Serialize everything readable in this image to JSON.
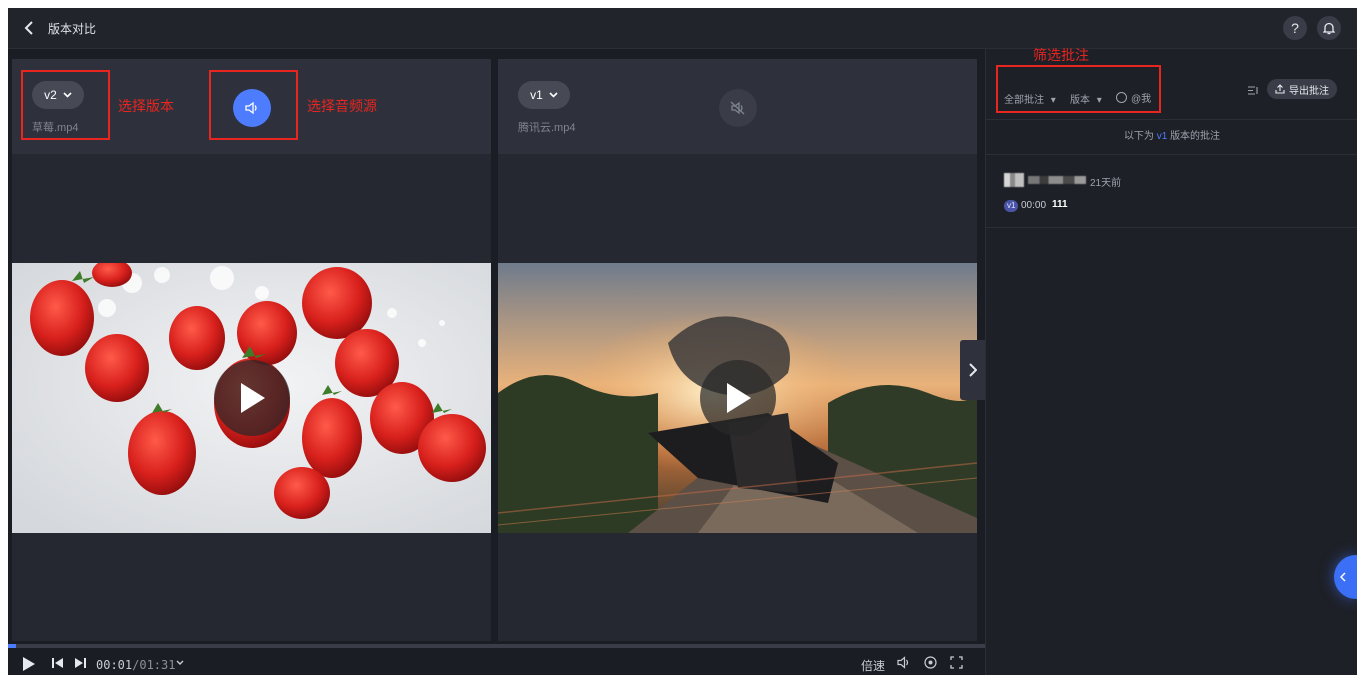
{
  "header": {
    "title": "版本对比"
  },
  "panels": [
    {
      "version": "v2",
      "file": "草莓.mp4",
      "audio": "active"
    },
    {
      "version": "v1",
      "file": "腾讯云.mp4",
      "audio": "muted"
    }
  ],
  "annotations": {
    "select_version": "选择版本",
    "select_audio": "选择音频源",
    "filter_comments": "筛选批注"
  },
  "player": {
    "current_time": "00:01",
    "separator": "/",
    "duration": "01:31",
    "progress_fraction": 0.0,
    "speed_label": "倍速"
  },
  "sidebar": {
    "filter_all": "全部批注",
    "filter_version": "版本",
    "filter_at_me": "@我",
    "export_label": "导出批注",
    "note_prefix": "以下为",
    "note_version": "v1",
    "note_suffix": "版本的批注",
    "comment": {
      "time_ago": "21天前",
      "version_tag": "v1",
      "timestamp": "00:00",
      "text": "111"
    }
  },
  "colors": {
    "accent": "#4d7cfe",
    "annotation_red": "#e8251f",
    "background": "#1b1d24"
  }
}
